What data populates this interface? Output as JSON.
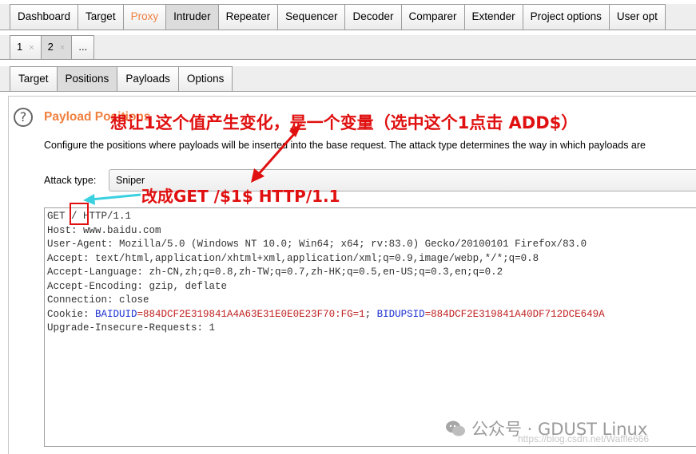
{
  "main_tabs": [
    {
      "label": "Dashboard"
    },
    {
      "label": "Target"
    },
    {
      "label": "Proxy"
    },
    {
      "label": "Intruder"
    },
    {
      "label": "Repeater"
    },
    {
      "label": "Sequencer"
    },
    {
      "label": "Decoder"
    },
    {
      "label": "Comparer"
    },
    {
      "label": "Extender"
    },
    {
      "label": "Project options"
    },
    {
      "label": "User opt"
    }
  ],
  "attack_tabs": [
    {
      "label": "1",
      "close": "×"
    },
    {
      "label": "2",
      "close": "×"
    },
    {
      "label": "..."
    }
  ],
  "sub_tabs": [
    {
      "label": "Target"
    },
    {
      "label": "Positions"
    },
    {
      "label": "Payloads"
    },
    {
      "label": "Options"
    }
  ],
  "section": {
    "help_glyph": "?",
    "title": "Payload Positions",
    "description": "Configure the positions where payloads will be inserted into the base request. The attack type determines the way in which payloads are"
  },
  "attack_type": {
    "label": "Attack type:",
    "value": "Sniper"
  },
  "request": {
    "line1": "GET / HTTP/1.1",
    "line2": "Host: www.baidu.com",
    "line3": "User-Agent: Mozilla/5.0 (Windows NT 10.0; Win64; x64; rv:83.0) Gecko/20100101 Firefox/83.0",
    "line4": "Accept: text/html,application/xhtml+xml,application/xml;q=0.9,image/webp,*/*;q=0.8",
    "line5": "Accept-Language: zh-CN,zh;q=0.8,zh-TW;q=0.7,zh-HK;q=0.5,en-US;q=0.3,en;q=0.2",
    "line6": "Accept-Encoding: gzip, deflate",
    "line7": "Connection: close",
    "cookie_prefix": "Cookie: ",
    "cookie_name1": "BAIDUID",
    "cookie_val1": "=884DCF2E319841A4A63E31E0E0E23F70:FG=1",
    "cookie_sep": "; ",
    "cookie_name2": "BIDUPSID",
    "cookie_val2": "=884DCF2E319841A40DF712DCE649A",
    "line9": "Upgrade-Insecure-Requests: 1"
  },
  "annotations": {
    "top": "想让1这个值产生变化，是一个变量（选中这个1点击 ADD$）",
    "mid": "改成GET /$1$ HTTP/1.1",
    "annotation_color": "#e01010",
    "arrow_mid_color": "#3ad0e0"
  },
  "watermark": {
    "text": "公众号 · GDUST Linux",
    "url": "https://blog.csdn.net/Waffle666"
  },
  "colors": {
    "accent_orange": "#f08040",
    "cookie_name": "#1a2fd0",
    "cookie_value": "#c02020"
  }
}
